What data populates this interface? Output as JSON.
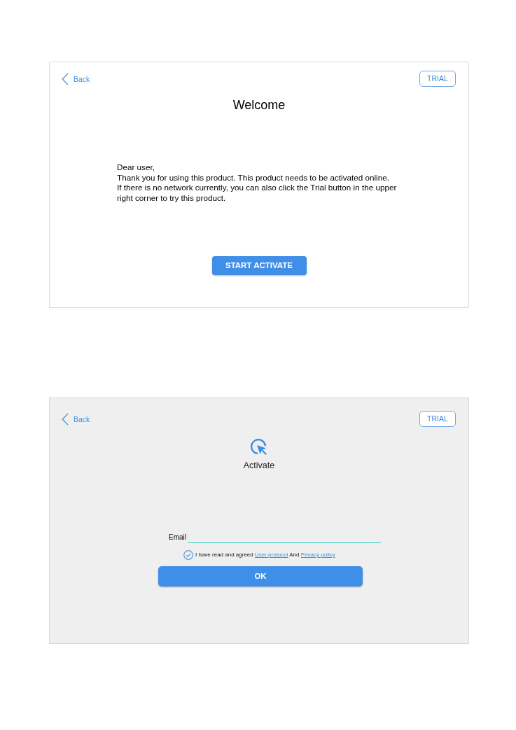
{
  "welcome_screen": {
    "back": "Back",
    "trial": "TRIAL",
    "title": "Welcome",
    "greeting": "Dear user,",
    "paragraphs": [
      "Thank you for using this product. This product needs to be activated online.",
      "If there is no network currently, you can also click the Trial button in the upper right corner to try this product."
    ],
    "start_button": "START ACTIVATE"
  },
  "activate_screen": {
    "back": "Back",
    "trial": "TRIAL",
    "title": "Activate",
    "email_label": "Email",
    "agreement": {
      "checked": true,
      "parts": [
        {
          "kind": "text",
          "text": "I have read and agreed"
        },
        {
          "kind": "link",
          "text": "User protocol"
        },
        {
          "kind": "text",
          "text": "And"
        },
        {
          "kind": "link",
          "text": "Privacy policy"
        }
      ]
    },
    "ok_button": "OK"
  }
}
